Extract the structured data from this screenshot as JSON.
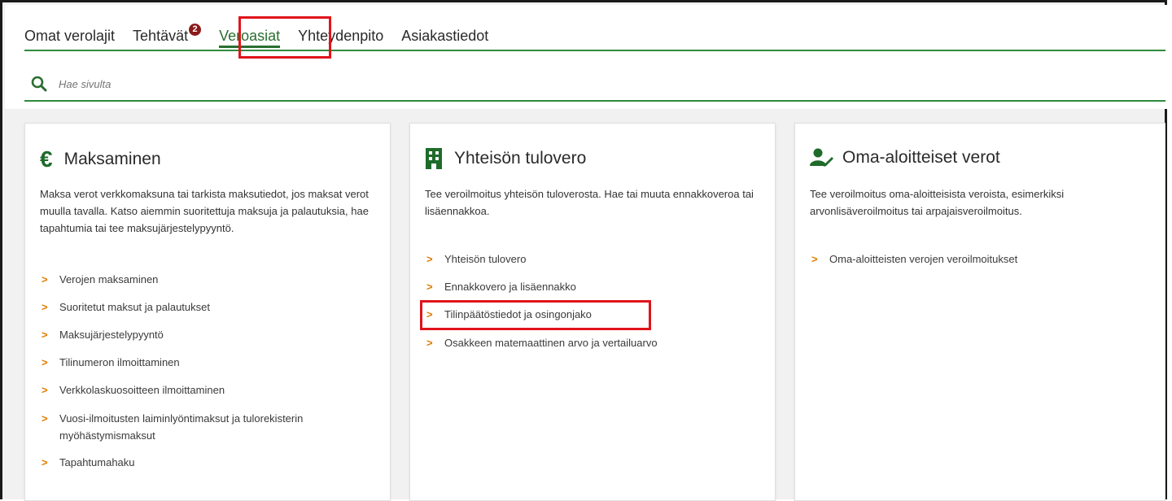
{
  "nav": {
    "items": [
      {
        "label": "Omat verolajit"
      },
      {
        "label": "Tehtävät",
        "badge": "2"
      },
      {
        "label": "Veroasiat"
      },
      {
        "label": "Yhteydenpito"
      },
      {
        "label": "Asiakastiedot"
      }
    ],
    "active_index": 2
  },
  "search": {
    "placeholder": "Hae sivulta"
  },
  "cards": [
    {
      "icon": "euro-icon",
      "title": "Maksaminen",
      "description": "Maksa verot verkkomaksuna tai tarkista maksutiedot, jos maksat verot muulla tavalla. Katso aiemmin suoritettuja maksuja ja palautuksia, hae tapahtumia tai tee maksujärjestelypyyntö.",
      "links": [
        "Verojen maksaminen",
        "Suoritetut maksut ja palautukset",
        "Maksujärjestelypyyntö",
        "Tilinumeron ilmoittaminen",
        "Verkkolaskuosoitteen ilmoittaminen",
        "Vuosi-ilmoitusten laiminlyöntimaksut ja tulorekisterin myöhästymismaksut",
        "Tapahtumahaku"
      ]
    },
    {
      "icon": "building-icon",
      "title": "Yhteisön tulovero",
      "description": "Tee veroilmoitus yhteisön tuloverosta. Hae tai muuta ennakkoveroa tai lisäennakkoa.",
      "links": [
        "Yhteisön tulovero",
        "Ennakkovero ja lisäennakko",
        "Tilinpäätöstiedot ja osingonjako",
        "Osakkeen matemaattinen arvo ja vertailuarvo"
      ]
    },
    {
      "icon": "person-edit-icon",
      "title": "Oma-aloitteiset verot",
      "description": "Tee veroilmoitus oma-aloitteisista veroista, esimerkiksi arvonlisäveroilmoitus tai arpajaisveroilmoitus.",
      "links": [
        "Oma-aloitteisten verojen veroilmoitukset"
      ]
    }
  ],
  "colors": {
    "accent_green": "#2e8b3e",
    "chevron_orange": "#e07b00",
    "highlight_red": "#e0141b",
    "badge_red": "#8b1a1a"
  }
}
